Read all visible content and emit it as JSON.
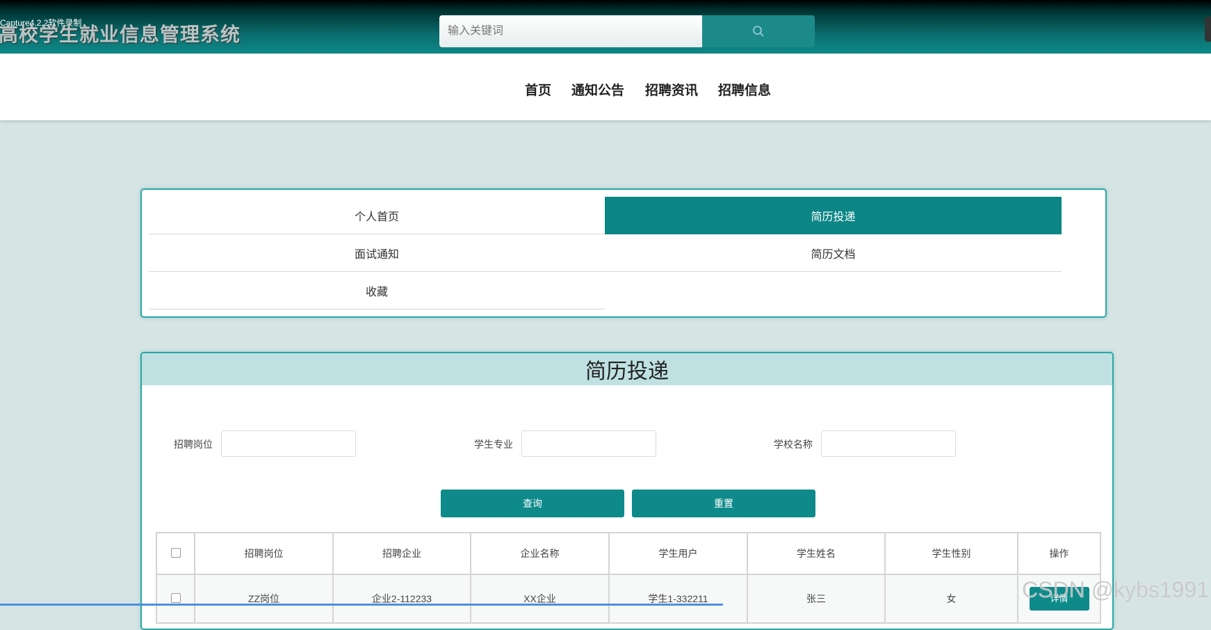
{
  "recorder_label": "Capture4.2.2软件录制",
  "site_title": "高校学生就业信息管理系统",
  "search": {
    "placeholder": "输入关键词"
  },
  "nav": {
    "items": [
      "首页",
      "通知公告",
      "招聘资讯",
      "招聘信息"
    ]
  },
  "tabs": [
    {
      "label": "个人首页",
      "active": false
    },
    {
      "label": "简历投递",
      "active": true
    },
    {
      "label": "面试通知",
      "active": false
    },
    {
      "label": "简历文档",
      "active": false
    },
    {
      "label": "收藏",
      "active": false
    }
  ],
  "panel": {
    "title": "简历投递",
    "filters": [
      {
        "label": "招聘岗位",
        "value": ""
      },
      {
        "label": "学生专业",
        "value": ""
      },
      {
        "label": "学校名称",
        "value": ""
      }
    ],
    "buttons": {
      "query": "查询",
      "reset": "重置"
    },
    "table": {
      "headers": [
        "招聘岗位",
        "招聘企业",
        "企业名称",
        "学生用户",
        "学生姓名",
        "学生性别",
        "操作"
      ],
      "rows": [
        {
          "cells": [
            "ZZ岗位",
            "企业2-112233",
            "XX企业",
            "学生1-332211",
            "张三",
            "女"
          ],
          "action": "详情"
        }
      ]
    }
  },
  "watermark": "CSDN @kybs1991",
  "colors": {
    "accent": "#0e8a8a",
    "header_bg": "#bfe1e1",
    "page_bg": "#d6e4e4"
  }
}
